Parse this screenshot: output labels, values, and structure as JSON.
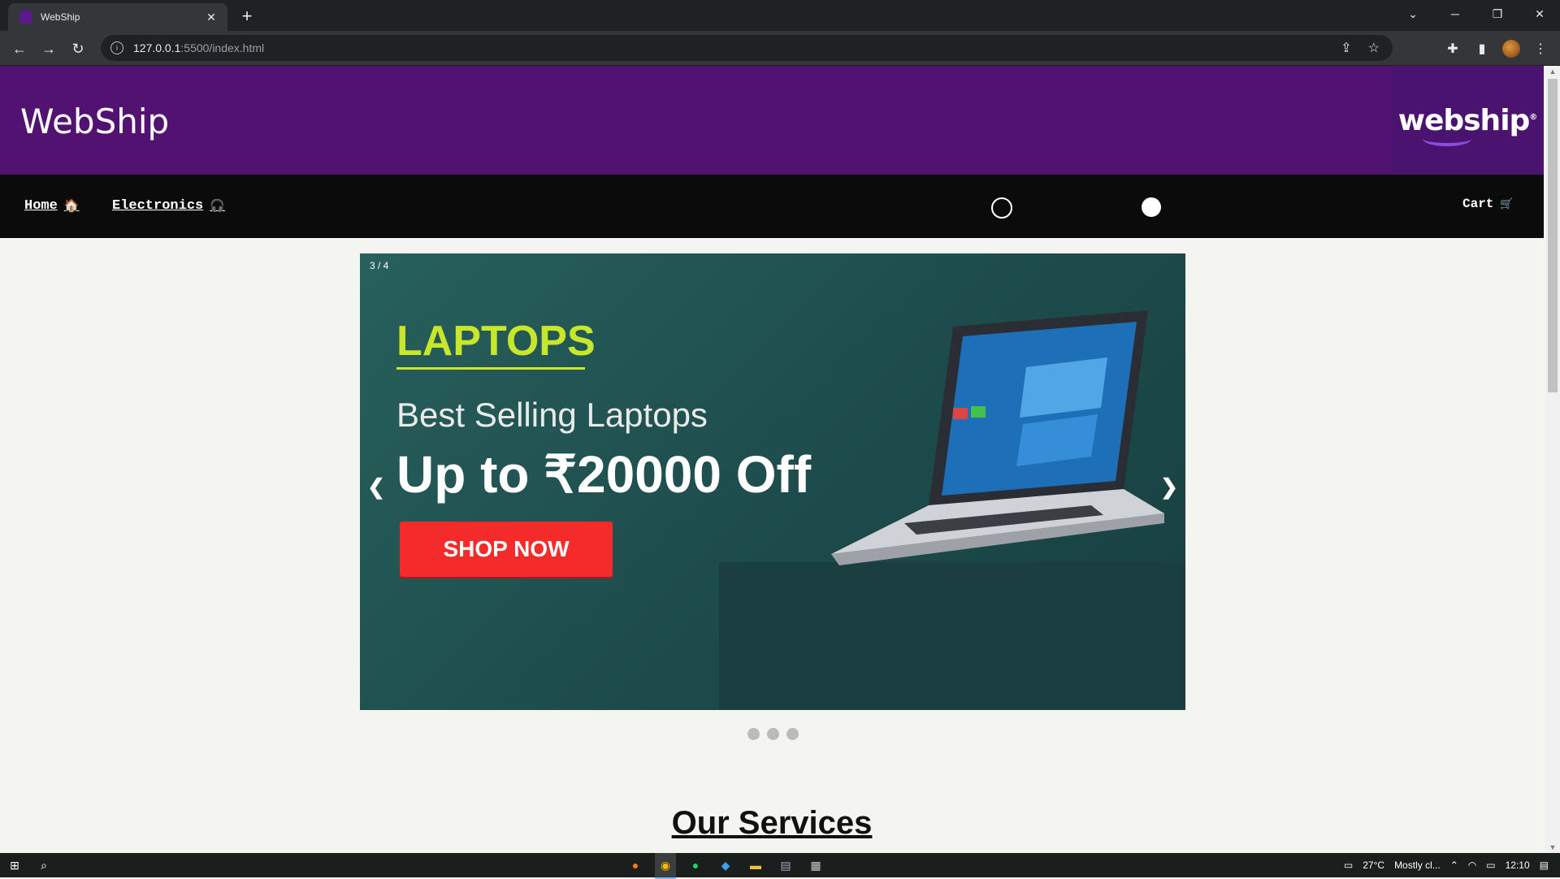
{
  "browser": {
    "tab_title": "WebShip",
    "tab_favicon_text": "webship",
    "url_host": "127.0.0.1",
    "url_path": ":5500/index.html"
  },
  "header": {
    "brand": "WebShip",
    "logo_text": "webship",
    "logo_mark": "®"
  },
  "nav": {
    "home_label": "Home",
    "home_icon": "🏠",
    "electronics_label": "Electronics",
    "electronics_icon": "🎧",
    "cart_label": "Cart",
    "cart_icon": "🛒"
  },
  "slideshow": {
    "counter": "3 / 4",
    "title": "LAPTOPS",
    "subtitle": "Best Selling Laptops",
    "offer": "Up to ₹20000 Off",
    "button_label": "SHOP NOW",
    "prev_label": "❮",
    "next_label": "❯",
    "dot_count": 3
  },
  "services": {
    "heading": "Our Services"
  },
  "taskbar": {
    "weather": "27°C",
    "weather_text": "Mostly cl...",
    "time": "12:10"
  },
  "colors": {
    "header_bg": "#521272",
    "nav_bg": "#0b0b0b",
    "slide_title": "#c8e62a",
    "shop_button": "#f52a2a"
  }
}
